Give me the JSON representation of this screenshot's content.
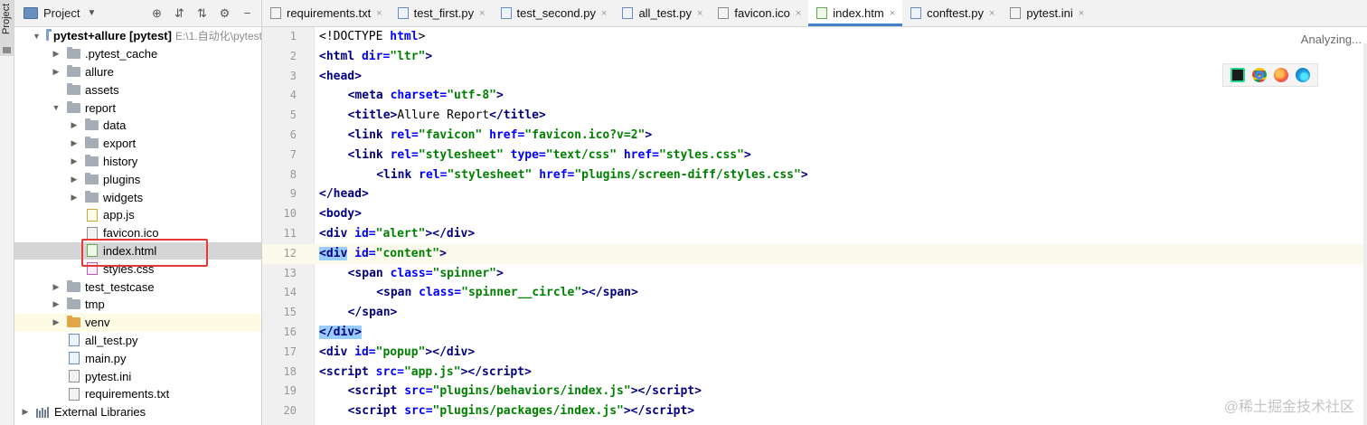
{
  "toolstrip": {
    "project_tab": "Project"
  },
  "project_panel": {
    "title": "Project",
    "tree": [
      {
        "label": "pytest+allure [pytest]",
        "path": "E:\\1.自动化\\pytest",
        "type": "folder",
        "depth": 0,
        "expanded": true,
        "bold": true
      },
      {
        "label": ".pytest_cache",
        "type": "folder",
        "depth": 1,
        "expanded": false
      },
      {
        "label": "allure",
        "type": "folder",
        "depth": 1,
        "expanded": false
      },
      {
        "label": "assets",
        "type": "folder",
        "depth": 1,
        "leaf": true
      },
      {
        "label": "report",
        "type": "folder",
        "depth": 1,
        "expanded": true
      },
      {
        "label": "data",
        "type": "folder",
        "depth": 2,
        "expanded": false
      },
      {
        "label": "export",
        "type": "folder",
        "depth": 2,
        "expanded": false
      },
      {
        "label": "history",
        "type": "folder",
        "depth": 2,
        "expanded": false
      },
      {
        "label": "plugins",
        "type": "folder",
        "depth": 2,
        "expanded": false
      },
      {
        "label": "widgets",
        "type": "folder",
        "depth": 2,
        "expanded": false
      },
      {
        "label": "app.js",
        "type": "js",
        "depth": 2
      },
      {
        "label": "favicon.ico",
        "type": "ico",
        "depth": 2
      },
      {
        "label": "index.html",
        "type": "html",
        "depth": 2,
        "selected": true
      },
      {
        "label": "styles.css",
        "type": "css",
        "depth": 2
      },
      {
        "label": "test_testcase",
        "type": "folder",
        "depth": 1,
        "expanded": false
      },
      {
        "label": "tmp",
        "type": "folder",
        "depth": 1,
        "expanded": false
      },
      {
        "label": "venv",
        "type": "folder-orange",
        "depth": 1,
        "expanded": false,
        "highlight": true
      },
      {
        "label": "all_test.py",
        "type": "py",
        "depth": 1
      },
      {
        "label": "main.py",
        "type": "py",
        "depth": 1
      },
      {
        "label": "pytest.ini",
        "type": "ini",
        "depth": 1
      },
      {
        "label": "requirements.txt",
        "type": "txt",
        "depth": 1
      },
      {
        "label": "External Libraries",
        "type": "lib",
        "depth": 0,
        "expanded": false
      }
    ]
  },
  "tabs": [
    {
      "label": "requirements.txt",
      "icon": "txt",
      "active": false
    },
    {
      "label": "test_first.py",
      "icon": "py",
      "active": false
    },
    {
      "label": "test_second.py",
      "icon": "py",
      "active": false
    },
    {
      "label": "all_test.py",
      "icon": "py",
      "active": false
    },
    {
      "label": "favicon.ico",
      "icon": "ico",
      "active": false
    },
    {
      "label": "index.htm",
      "icon": "html",
      "active": true
    },
    {
      "label": "conftest.py",
      "icon": "py",
      "active": false
    },
    {
      "label": "pytest.ini",
      "icon": "ini",
      "active": false
    }
  ],
  "editor": {
    "status": "Analyzing...",
    "current_line": 12,
    "lines": [
      {
        "n": 1,
        "indent": 0,
        "html": "<span class='punct'>&lt;!DOCTYPE </span><span class='attr'>html</span><span class='punct'>&gt;</span>"
      },
      {
        "n": 2,
        "indent": 0,
        "html": "<span class='tag'>&lt;html </span><span class='attr'>dir=</span><span class='val'>\"ltr\"</span><span class='tag'>&gt;</span>"
      },
      {
        "n": 3,
        "indent": 0,
        "html": "<span class='tag'>&lt;head&gt;</span>"
      },
      {
        "n": 4,
        "indent": 1,
        "html": "<span class='tag'>&lt;meta </span><span class='attr'>charset=</span><span class='val'>\"utf-8\"</span><span class='tag'>&gt;</span>"
      },
      {
        "n": 5,
        "indent": 1,
        "html": "<span class='tag'>&lt;title&gt;</span><span class='txt'>Allure Report</span><span class='tag'>&lt;/title&gt;</span>"
      },
      {
        "n": 6,
        "indent": 1,
        "html": "<span class='tag'>&lt;link </span><span class='attr'>rel=</span><span class='val'>\"favicon\" </span><span class='attr'>href=</span><span class='val'>\"favicon.ico?v=2\"</span><span class='tag'>&gt;</span>"
      },
      {
        "n": 7,
        "indent": 1,
        "html": "<span class='tag'>&lt;link </span><span class='attr'>rel=</span><span class='val'>\"stylesheet\" </span><span class='attr'>type=</span><span class='val'>\"text/css\" </span><span class='attr'>href=</span><span class='val'>\"styles.css\"</span><span class='tag'>&gt;</span>"
      },
      {
        "n": 8,
        "indent": 2,
        "html": "<span class='tag'>&lt;link </span><span class='attr'>rel=</span><span class='val'>\"stylesheet\" </span><span class='attr'>href=</span><span class='val'>\"plugins/screen-diff/styles.css\"</span><span class='tag'>&gt;</span>"
      },
      {
        "n": 9,
        "indent": 0,
        "html": "<span class='tag'>&lt;/head&gt;</span>"
      },
      {
        "n": 10,
        "indent": 0,
        "html": "<span class='tag'>&lt;body&gt;</span>"
      },
      {
        "n": 11,
        "indent": 0,
        "html": "<span class='tag'>&lt;div </span><span class='attr'>id=</span><span class='val'>\"alert\"</span><span class='tag'>&gt;&lt;/div&gt;</span>"
      },
      {
        "n": 12,
        "indent": 0,
        "html": "<span class='tag match'>&lt;div</span><span class='tag'> </span><span class='attr'>id=</span><span class='val'>\"content\"</span><span class='tag'>&gt;</span>"
      },
      {
        "n": 13,
        "indent": 1,
        "html": "<span class='tag'>&lt;span </span><span class='attr'>class=</span><span class='val'>\"spinner\"</span><span class='tag'>&gt;</span>"
      },
      {
        "n": 14,
        "indent": 2,
        "html": "<span class='tag'>&lt;span </span><span class='attr'>class=</span><span class='val'>\"spinner__circle\"</span><span class='tag'>&gt;&lt;/span&gt;</span>"
      },
      {
        "n": 15,
        "indent": 1,
        "html": "<span class='tag'>&lt;/span&gt;</span>"
      },
      {
        "n": 16,
        "indent": 0,
        "html": "<span class='tag match'>&lt;/div&gt;</span>"
      },
      {
        "n": 17,
        "indent": 0,
        "html": "<span class='tag'>&lt;div </span><span class='attr'>id=</span><span class='val'>\"popup\"</span><span class='tag'>&gt;&lt;/div&gt;</span>"
      },
      {
        "n": 18,
        "indent": 0,
        "html": "<span class='tag'>&lt;script </span><span class='attr'>src=</span><span class='val'>\"app.js\"</span><span class='tag'>&gt;&lt;/script&gt;</span>"
      },
      {
        "n": 19,
        "indent": 1,
        "html": "<span class='tag'>&lt;script </span><span class='attr'>src=</span><span class='val'>\"plugins/behaviors/index.js\"</span><span class='tag'>&gt;&lt;/script&gt;</span>"
      },
      {
        "n": 20,
        "indent": 1,
        "html": "<span class='tag'>&lt;script </span><span class='attr'>src=</span><span class='val'>\"plugins/packages/index.js\"</span><span class='tag'>&gt;&lt;/script&gt;</span>"
      }
    ]
  },
  "browser_icons": [
    "pycharm-icon",
    "chrome-icon",
    "firefox-icon",
    "edge-icon"
  ],
  "watermark": "@稀土掘金技术社区",
  "colors": {
    "accent": "#4083c9",
    "selection": "#d5d5d5",
    "bracket_match": "#99ccff",
    "annotation_box": "#e53935"
  }
}
